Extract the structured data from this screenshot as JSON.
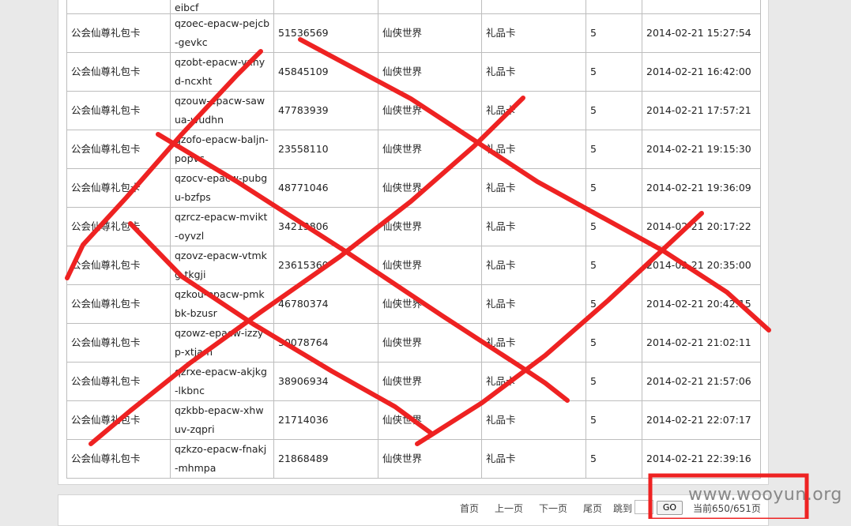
{
  "table": {
    "partial_row": {
      "code_tail": "eibcf"
    },
    "rows": [
      {
        "name": "公会仙尊礼包卡",
        "code": "qzoec-epacw-pejcb-gevkc",
        "number": "51536569",
        "game": "仙侠世界",
        "type": "礼品卡",
        "qty": "5",
        "time": "2014-02-21 15:27:54"
      },
      {
        "name": "公会仙尊礼包卡",
        "code": "qzobt-epacw-vxhyd-ncxht",
        "number": "45845109",
        "game": "仙侠世界",
        "type": "礼品卡",
        "qty": "5",
        "time": "2014-02-21 16:42:00"
      },
      {
        "name": "公会仙尊礼包卡",
        "code": "qzouw-epacw-sawua-wudhn",
        "number": "47783939",
        "game": "仙侠世界",
        "type": "礼品卡",
        "qty": "5",
        "time": "2014-02-21 17:57:21"
      },
      {
        "name": "公会仙尊礼包卡",
        "code": "qzofo-epacw-baljn-popvc",
        "number": "23558110",
        "game": "仙侠世界",
        "type": "礼品卡",
        "qty": "5",
        "time": "2014-02-21 19:15:30"
      },
      {
        "name": "公会仙尊礼包卡",
        "code": "qzocv-epacw-pubgu-bzfps",
        "number": "48771046",
        "game": "仙侠世界",
        "type": "礼品卡",
        "qty": "5",
        "time": "2014-02-21 19:36:09"
      },
      {
        "name": "公会仙尊礼包卡",
        "code": "qzrcz-epacw-mvikt-oyvzl",
        "number": "34213806",
        "game": "仙侠世界",
        "type": "礼品卡",
        "qty": "5",
        "time": "2014-02-21 20:17:22"
      },
      {
        "name": "公会仙尊礼包卡",
        "code": "qzovz-epacw-vtmkg-tkgji",
        "number": "23615360",
        "game": "仙侠世界",
        "type": "礼品卡",
        "qty": "5",
        "time": "2014-02-21 20:35:00"
      },
      {
        "name": "公会仙尊礼包卡",
        "code": "qzkou-epacw-pmkbk-bzusr",
        "number": "46780374",
        "game": "仙侠世界",
        "type": "礼品卡",
        "qty": "5",
        "time": "2014-02-21 20:42:15"
      },
      {
        "name": "公会仙尊礼包卡",
        "code": "qzowz-epacw-izzyp-xtjam",
        "number": "30078764",
        "game": "仙侠世界",
        "type": "礼品卡",
        "qty": "5",
        "time": "2014-02-21 21:02:11"
      },
      {
        "name": "公会仙尊礼包卡",
        "code": "qzrxe-epacw-akjkg-lkbnc",
        "number": "38906934",
        "game": "仙侠世界",
        "type": "礼品卡",
        "qty": "5",
        "time": "2014-02-21 21:57:06"
      },
      {
        "name": "公会仙尊礼包卡",
        "code": "qzkbb-epacw-xhwuv-zqpri",
        "number": "21714036",
        "game": "仙侠世界",
        "type": "礼品卡",
        "qty": "5",
        "time": "2014-02-21 22:07:17"
      },
      {
        "name": "公会仙尊礼包卡",
        "code": "qzkzo-epacw-fnakj-mhmpa",
        "number": "21868489",
        "game": "仙侠世界",
        "type": "礼品卡",
        "qty": "5",
        "time": "2014-02-21 22:39:16"
      }
    ]
  },
  "pager": {
    "first": "首页",
    "prev": "上一页",
    "next": "下一页",
    "last": "尾页",
    "jump_label": "跳到",
    "go": "GO",
    "status": "当前650/651页"
  },
  "watermark": "www.wooyun.org",
  "colors": {
    "annotation": "#ee2222",
    "border": "#bdbdbd"
  }
}
